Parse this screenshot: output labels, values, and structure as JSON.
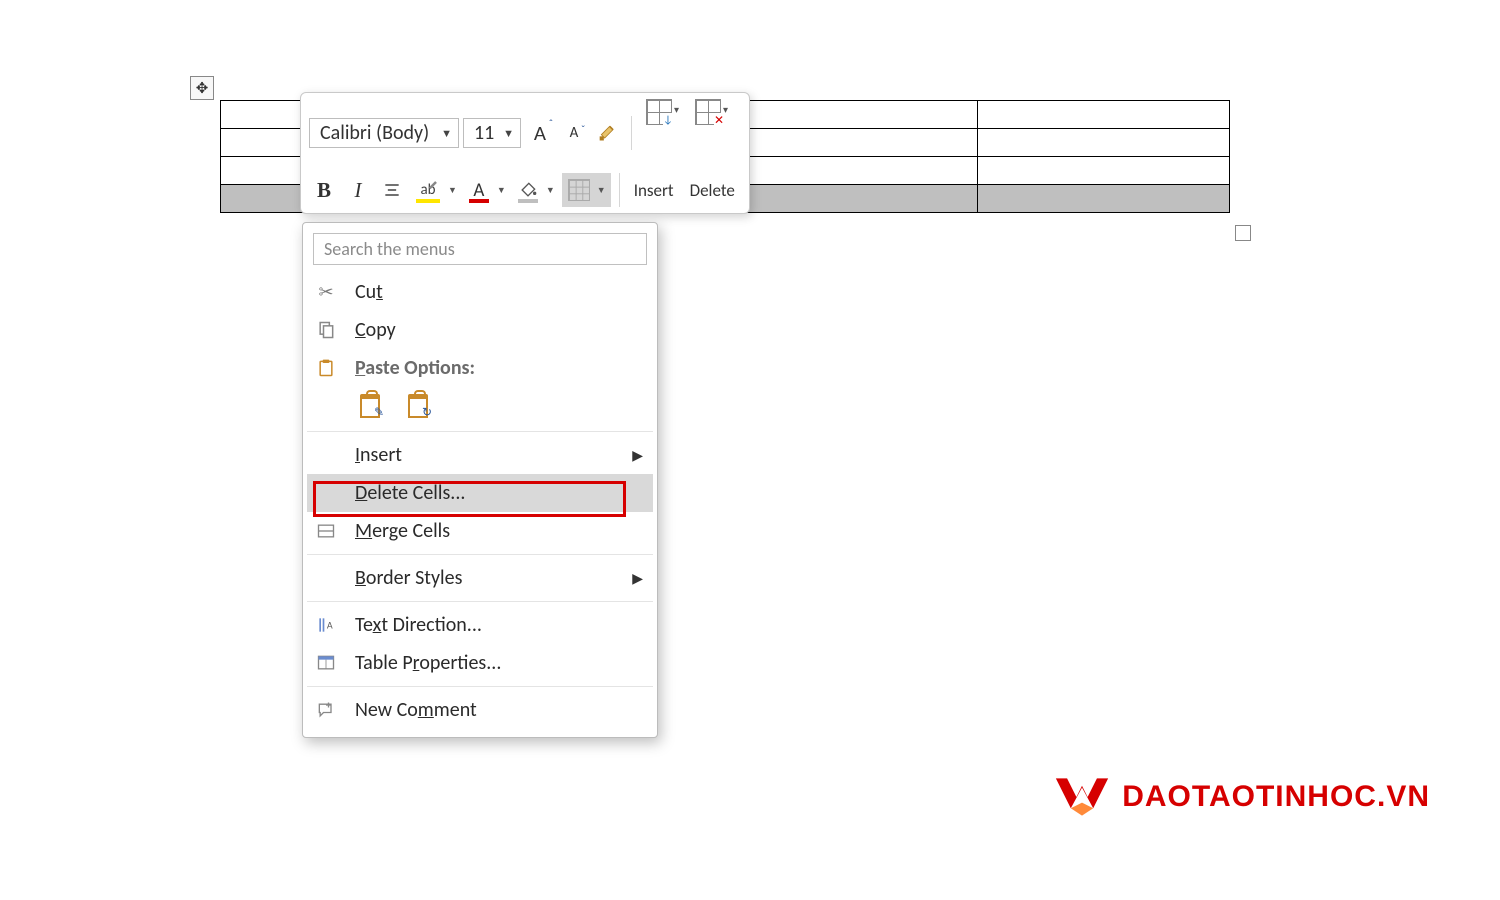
{
  "table": {
    "rows": 4,
    "cols": 4,
    "selected_row_index": 3
  },
  "mini_toolbar": {
    "font_name": "Calibri (Body)",
    "font_size": "11",
    "grow_font_icon": "A",
    "shrink_font_icon": "A",
    "format_painter_icon": "format-painter",
    "bold_label": "B",
    "italic_label": "I",
    "align_icon": "align-center",
    "highlight_letter": "ab",
    "font_color_letter": "A",
    "shading_icon": "paint-bucket",
    "borders_icon": "borders",
    "insert_label": "Insert",
    "delete_label": "Delete"
  },
  "context_menu": {
    "search_placeholder": "Search the menus",
    "items": {
      "cut": {
        "label_pre": "Cu",
        "underline": "t",
        "label_post": ""
      },
      "copy": {
        "label_pre": "",
        "underline": "C",
        "label_post": "opy"
      },
      "paste_options": {
        "label_pre": "",
        "underline": "P",
        "label_post": "aste Options:"
      },
      "insert": {
        "label_pre": "",
        "underline": "I",
        "label_post": "nsert"
      },
      "delete_cells": {
        "label_pre": "",
        "underline": "D",
        "label_post": "elete Cells..."
      },
      "merge_cells": {
        "label_pre": "",
        "underline": "M",
        "label_post": "erge Cells"
      },
      "border_styles": {
        "label_pre": "",
        "underline": "B",
        "label_post": "order Styles"
      },
      "text_direction": {
        "label_pre": "Te",
        "underline": "x",
        "label_post": "t Direction..."
      },
      "table_props": {
        "label_pre": "Table P",
        "underline": "r",
        "label_post": "operties..."
      },
      "new_comment": {
        "label_pre": "New Co",
        "underline": "m",
        "label_post": "ment"
      }
    }
  },
  "watermark": {
    "text": "DAOTAOTINHOC",
    "suffix": ".VN"
  },
  "colors": {
    "highlight_yellow": "#ffe600",
    "font_color_red": "#d60000",
    "selection_gray": "#bfbfbf",
    "callout_red": "#d60000"
  }
}
